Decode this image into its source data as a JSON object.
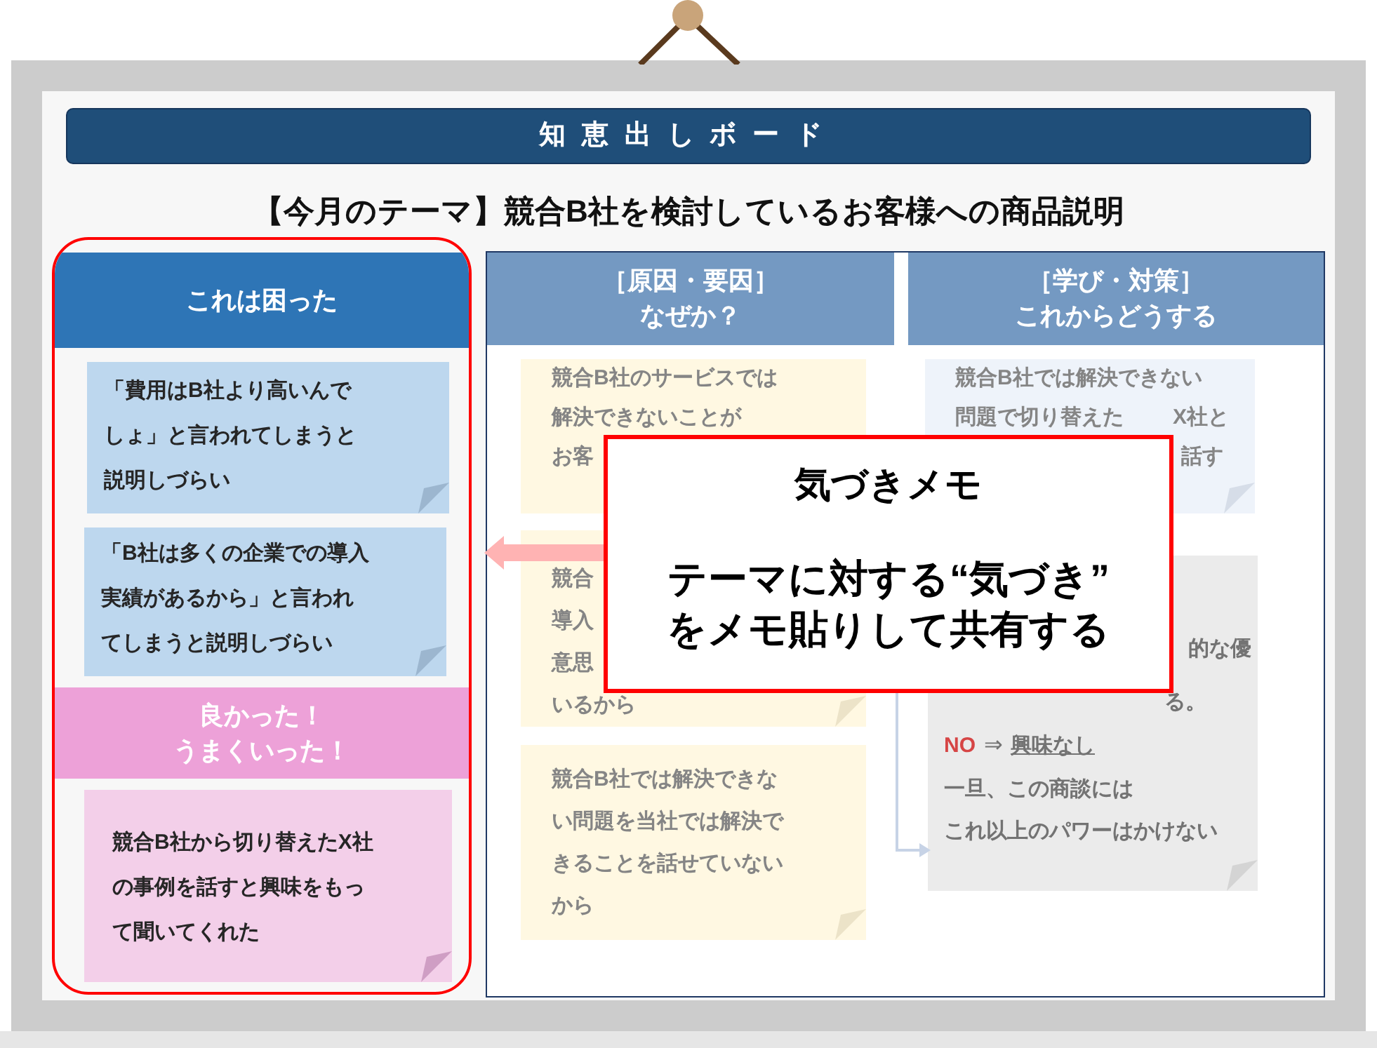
{
  "board": {
    "title": "知恵出しボード",
    "theme": "【今月のテーマ】競合B社を検討しているお客様への商品説明"
  },
  "problems": {
    "header": [
      "これは困った"
    ],
    "notes": [
      [
        "「費用はB社より高いんで",
        "しょ」と言われてしまうと",
        "説明しづらい"
      ],
      [
        "「B社は多くの企業での導入",
        "実績があるから」と言われ",
        "てしまうと説明しづらい"
      ]
    ]
  },
  "successes": {
    "header": [
      "良かった！",
      "うまくいった！"
    ],
    "notes": [
      [
        "競合B社から切り替えたX社",
        "の事例を話すと興味をもっ",
        "て聞いてくれた"
      ]
    ]
  },
  "causes": {
    "header": [
      "［原因・要因］",
      "なぜか？"
    ],
    "notes": [
      [
        "競合B社のサービスでは",
        "解決できないことが",
        "お客"
      ],
      [
        "競合",
        "導入",
        "意思",
        "いるから"
      ],
      [
        "競合B社では解決できな",
        "い問題を当社では解決で",
        "きることを話せていない",
        "から"
      ]
    ]
  },
  "measures": {
    "header": [
      "［学び・対策］",
      "これからどうする"
    ],
    "notes": [
      {
        "lines": [
          "競合B社では解決できない",
          "問題で切り替えた",
          "X社と",
          "話す"
        ]
      },
      {
        "lines": [
          "的な優",
          "る。"
        ],
        "verdict": {
          "label": "NO",
          "arrow": "⇒",
          "value": "興味なし"
        },
        "after": [
          "一旦、この商談には",
          "これ以上のパワーはかけない"
        ]
      }
    ]
  },
  "memo": {
    "title": "気づきメモ",
    "body": [
      "テーマに対する“気づき”",
      "をメモ貼りして共有する"
    ]
  }
}
